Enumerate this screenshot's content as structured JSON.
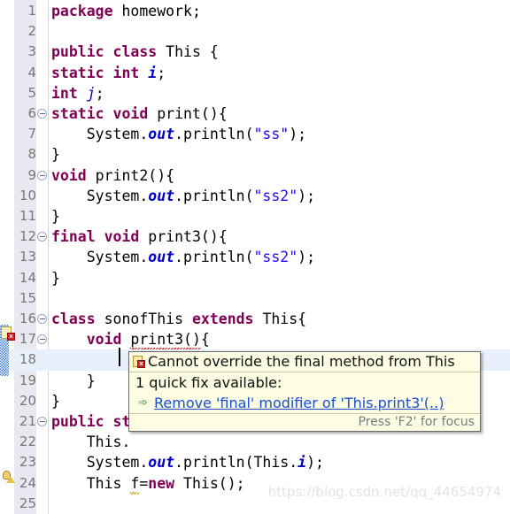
{
  "editor": {
    "app": "Eclipse Java Editor",
    "language": "java",
    "current_line": 18,
    "colors": {
      "gutter_bg": "#e8e8f0",
      "line_number": "#787878",
      "keyword": "#7f0055",
      "field": "#0000c0",
      "string": "#2a00ff",
      "current_line_bg": "#e8f0fb",
      "error_squiggle": "#d62020",
      "warning_squiggle": "#c8a000",
      "tooltip_bg": "#fdfde4",
      "link": "#1a4fcf"
    },
    "lines": [
      {
        "num": "1",
        "fold": false,
        "segments": [
          {
            "t": "package ",
            "c": "kw"
          },
          {
            "t": "homework;",
            "c": "plain"
          }
        ]
      },
      {
        "num": "2",
        "fold": false,
        "segments": []
      },
      {
        "num": "3",
        "fold": false,
        "segments": [
          {
            "t": "public class ",
            "c": "kw"
          },
          {
            "t": "This {",
            "c": "plain"
          }
        ]
      },
      {
        "num": "4",
        "fold": false,
        "segments": [
          {
            "t": "static int ",
            "c": "kw"
          },
          {
            "t": "i",
            "c": "sfld"
          },
          {
            "t": ";",
            "c": "plain"
          }
        ]
      },
      {
        "num": "5",
        "fold": false,
        "segments": [
          {
            "t": "int ",
            "c": "kw"
          },
          {
            "t": "j",
            "c": "fld"
          },
          {
            "t": ";",
            "c": "plain"
          }
        ]
      },
      {
        "num": "6",
        "fold": true,
        "segments": [
          {
            "t": "static void ",
            "c": "kw"
          },
          {
            "t": "print(){",
            "c": "plain"
          }
        ]
      },
      {
        "num": "7",
        "fold": false,
        "segments": [
          {
            "t": "    System.",
            "c": "plain"
          },
          {
            "t": "out",
            "c": "sfld"
          },
          {
            "t": ".println(",
            "c": "plain"
          },
          {
            "t": "\"ss\"",
            "c": "str"
          },
          {
            "t": ");",
            "c": "plain"
          }
        ]
      },
      {
        "num": "8",
        "fold": false,
        "segments": [
          {
            "t": "}",
            "c": "plain"
          }
        ]
      },
      {
        "num": "9",
        "fold": true,
        "segments": [
          {
            "t": "void ",
            "c": "kw"
          },
          {
            "t": "print2(){",
            "c": "plain"
          }
        ]
      },
      {
        "num": "10",
        "fold": false,
        "segments": [
          {
            "t": "    System.",
            "c": "plain"
          },
          {
            "t": "out",
            "c": "sfld"
          },
          {
            "t": ".println(",
            "c": "plain"
          },
          {
            "t": "\"ss2\"",
            "c": "str"
          },
          {
            "t": ");",
            "c": "plain"
          }
        ]
      },
      {
        "num": "11",
        "fold": false,
        "segments": [
          {
            "t": "}",
            "c": "plain"
          }
        ]
      },
      {
        "num": "12",
        "fold": true,
        "segments": [
          {
            "t": "final void ",
            "c": "kw"
          },
          {
            "t": "print3(){",
            "c": "plain"
          }
        ]
      },
      {
        "num": "13",
        "fold": false,
        "segments": [
          {
            "t": "    System.",
            "c": "plain"
          },
          {
            "t": "out",
            "c": "sfld"
          },
          {
            "t": ".println(",
            "c": "plain"
          },
          {
            "t": "\"ss2\"",
            "c": "str"
          },
          {
            "t": ");",
            "c": "plain"
          }
        ]
      },
      {
        "num": "14",
        "fold": false,
        "segments": [
          {
            "t": "}",
            "c": "plain"
          }
        ]
      },
      {
        "num": "15",
        "fold": false,
        "segments": []
      },
      {
        "num": "16",
        "fold": true,
        "segments": [
          {
            "t": "class ",
            "c": "kw"
          },
          {
            "t": "sonofThis ",
            "c": "plain"
          },
          {
            "t": "extends ",
            "c": "kw"
          },
          {
            "t": "This{",
            "c": "plain"
          }
        ]
      },
      {
        "num": "17",
        "fold": true,
        "segments": [
          {
            "t": "    ",
            "c": "plain"
          },
          {
            "t": "void ",
            "c": "kw"
          },
          {
            "t": "print3()",
            "c": "plain",
            "squiggle": "error"
          },
          {
            "t": "{",
            "c": "plain"
          }
        ]
      },
      {
        "num": "18",
        "fold": false,
        "segments": []
      },
      {
        "num": "19",
        "fold": false,
        "segments": [
          {
            "t": "    }",
            "c": "plain"
          }
        ]
      },
      {
        "num": "20",
        "fold": false,
        "segments": [
          {
            "t": "}",
            "c": "plain"
          }
        ]
      },
      {
        "num": "21",
        "fold": true,
        "segments": [
          {
            "t": "public st",
            "c": "kw"
          }
        ]
      },
      {
        "num": "22",
        "fold": false,
        "segments": [
          {
            "t": "    This.",
            "c": "plain"
          }
        ]
      },
      {
        "num": "23",
        "fold": false,
        "segments": [
          {
            "t": "    System.",
            "c": "plain"
          },
          {
            "t": "out",
            "c": "sfld"
          },
          {
            "t": ".println(This.",
            "c": "plain"
          },
          {
            "t": "i",
            "c": "sfld"
          },
          {
            "t": ");",
            "c": "plain"
          }
        ]
      },
      {
        "num": "24",
        "fold": false,
        "segments": [
          {
            "t": "    This ",
            "c": "plain"
          },
          {
            "t": "f",
            "c": "plain",
            "squiggle": "warning"
          },
          {
            "t": "=",
            "c": "plain"
          },
          {
            "t": "new ",
            "c": "kw"
          },
          {
            "t": "This();",
            "c": "plain"
          }
        ]
      },
      {
        "num": "25",
        "fold": false,
        "segments": []
      }
    ],
    "markers": {
      "error_line": "17",
      "error_icon": "error-marker-icon",
      "warning_line": "24",
      "warning_icon": "warning-bulb-icon"
    }
  },
  "tooltip": {
    "title": "Cannot override the final method from This",
    "title_icon": "error-marker-icon",
    "subtitle": "1 quick fix available:",
    "fix_icon": "quickfix-arrow-icon",
    "fix_label": "Remove 'final' modifier of 'This.print3'(..)",
    "footer": "Press 'F2' for focus"
  },
  "watermark": {
    "text": "https://blog.csdn.net/qq_44654974"
  }
}
